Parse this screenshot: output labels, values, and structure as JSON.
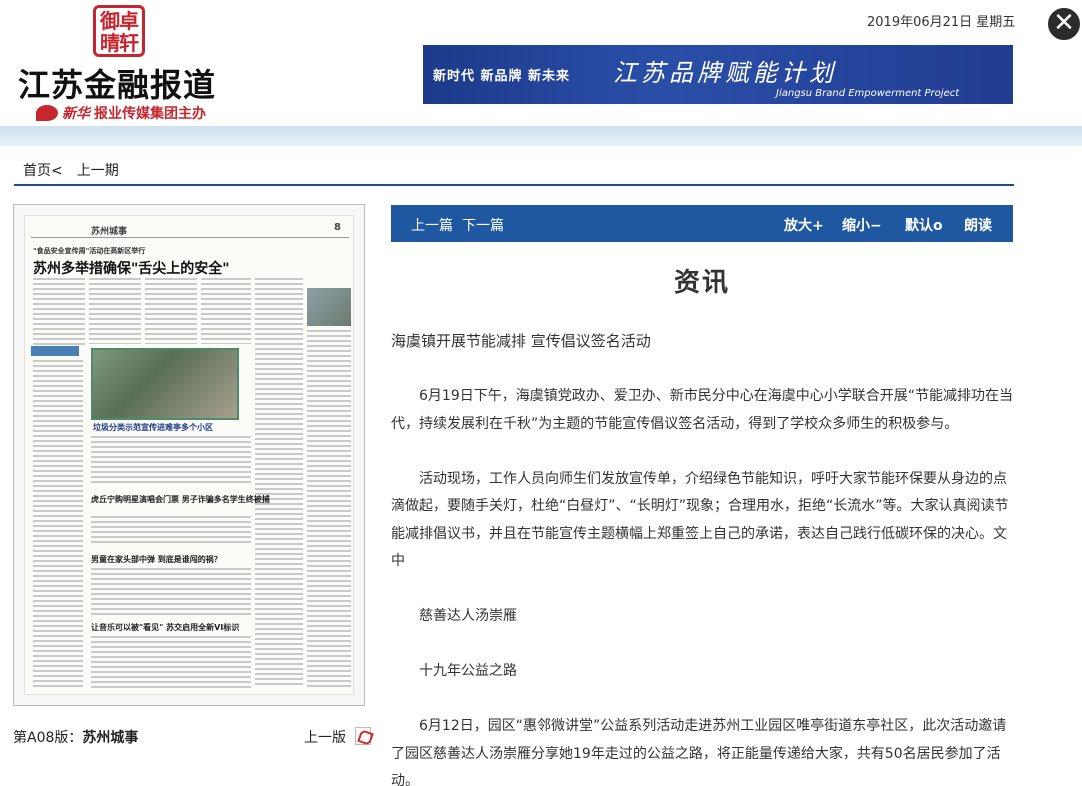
{
  "header": {
    "seal_text": "御卓 晴轩",
    "seal_chars": [
      "御",
      "卓",
      "晴",
      "轩"
    ],
    "logo_title": "江苏金融报道",
    "logo_sub": "报业传媒集团主办",
    "logo_sub_prefix": "新华",
    "date": "2019年06月21日  星期五",
    "close_label": "✕",
    "banner": {
      "slogan": "新时代  新品牌  新未来",
      "title": "江苏品牌赋能计划",
      "subtitle": "Jiangsu Brand Empowerment Project"
    }
  },
  "nav": {
    "home": "首页<",
    "prev_issue": "上一期"
  },
  "thumbnail": {
    "section": "苏州城事",
    "page_num": "8",
    "kicker": "\"食品安全宣传周\"活动在高新区举行",
    "headline": "苏州多举措确保\"舌尖上的安全\"",
    "headlines": [
      "垃圾分类示范宣传进难亭多个小区",
      "虎丘宁购明星演唱会门票 男子诈骗多名学生终被捕",
      "男童在家头部中弹 到底是谁闯的祸？",
      "让音乐可以被\"看见\" 苏交启用全新VI标识"
    ]
  },
  "issue": {
    "label_prefix": "第A08版：",
    "label_name": "苏州城事",
    "prev_edition": "上一版"
  },
  "toolbar": {
    "prev_article": "上一篇",
    "next_article": "下一篇",
    "zoom_in": "放大+",
    "zoom_out": "缩小−",
    "default": "默认o",
    "read_aloud": "朗读"
  },
  "article": {
    "title": "资讯",
    "subhead": "海虞镇开展节能减排 宣传倡议签名活动",
    "paragraphs": [
      "6月19日下午，海虞镇党政办、爱卫办、新市民分中心在海虞中心小学联合开展“节能减排功在当代，持续发展利在千秋”为主题的节能宣传倡议签名活动，得到了学校众多师生的积极参与。",
      "活动现场，工作人员向师生们发放宣传单，介绍绿色节能知识，呼吁大家节能环保要从身边的点滴做起，要随手关灯，杜绝“白昼灯”、“长明灯”现象；合理用水，拒绝“长流水”等。大家认真阅读节能减排倡议书，并且在节能宣传主题横幅上郑重签上自己的承诺，表达自己践行低碳环保的决心。文中",
      "慈善达人汤崇雁",
      "十九年公益之路",
      "6月12日，园区“惠邻微讲堂”公益系列活动走进苏州工业园区唯亭街道东亭社区，此次活动邀请了园区慈善达人汤崇雁分享她19年走过的公益之路，将正能量传递给大家，共有50名居民参加了活动。"
    ]
  }
}
